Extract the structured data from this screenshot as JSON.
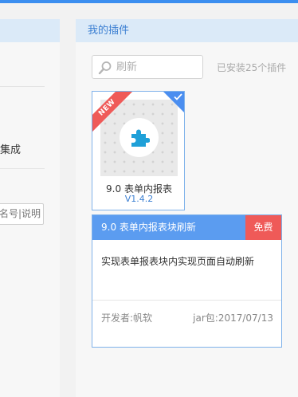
{
  "colors": {
    "accent": "#3c8ff0",
    "header_bg": "#dbeaf8",
    "title_blue": "#3b7fd2",
    "detail_header": "#5b9cf0",
    "free_badge": "#ef5a58",
    "new_ribbon": "#ef5a58"
  },
  "left_panel": {
    "text_fragment": "集成",
    "button_label": "名号|说明"
  },
  "right_panel": {
    "title": "我的插件",
    "search": {
      "placeholder": "刷新",
      "icon": "search-icon"
    },
    "installed_count": "已安装25个插件",
    "plugin_card": {
      "ribbon": "NEW",
      "name": "9.0 表单内报表",
      "version": "V1.4.2",
      "icon": "puzzle-icon",
      "selected": true
    },
    "detail": {
      "title": "9.0 表单内报表块刷新",
      "badge": "免费",
      "description": "实现表单报表块内实现页面自动刷新",
      "developer": "开发者:帆软",
      "jar": "jar包:2017/07/13"
    }
  }
}
